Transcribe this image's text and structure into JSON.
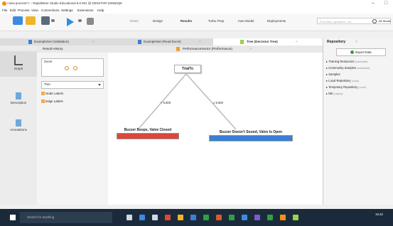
{
  "window": {
    "title": "<new process*> – RapidMiner Studio Educational 9.0.001 @ DESKTOP-2SNB3QK",
    "min": "–",
    "max": "□"
  },
  "menu": [
    "File",
    "Edit",
    "Process",
    "View",
    "Connections",
    "Settings",
    "Extensions",
    "Help"
  ],
  "toolbar": {
    "views_label": "Views:",
    "perspectives": [
      "Design",
      "Results",
      "Turbo Prep",
      "Auto Model",
      "Deployments"
    ],
    "active": "Results",
    "search_placeholder": "Find data, operators...etc",
    "all_studio": "All Studio"
  },
  "tabs": [
    {
      "label": "ExampleSet (Validation)",
      "close": "×"
    },
    {
      "label": "ExampleSet (Read Excel)",
      "close": "×"
    },
    {
      "label": "Tree (Decision Tree)",
      "close": "×"
    }
  ],
  "result_history": "Result History",
  "performance_tab": "PerformanceVector (Performance)",
  "performance_close": "×",
  "leftnav": [
    "Graph",
    "Description",
    "Annotations"
  ],
  "controls": {
    "zoom_label": "Zoom",
    "tree_select": "Tree",
    "node_labels": "Node Labels",
    "edge_labels": "Edge Labels",
    "check": "✓"
  },
  "tree": {
    "root": "TrialTo",
    "left_edge": "< 5.500",
    "right_edge": "≥ 5.500",
    "left_leaf": "Buzzer Beeps, Valve Closed",
    "right_leaf": "Buzzer Doesn't Sound, Valve Is Open"
  },
  "repo": {
    "title": "Repository",
    "close": "×",
    "import_label": "Import Data",
    "items": [
      {
        "label": "Training Resources",
        "conn": "(connected)"
      },
      {
        "label": "Community Samples",
        "conn": "(connected)"
      },
      {
        "label": "Samples",
        "conn": ""
      },
      {
        "label": "Local Repository",
        "conn": "(Local)"
      },
      {
        "label": "Temporary Repository",
        "conn": "(Local)"
      },
      {
        "label": "DB",
        "conn": "(Legacy)"
      }
    ]
  },
  "taskbar": {
    "search": "Search for anything",
    "time": "16:42"
  },
  "colors": {
    "leaf_left": "#e0453a",
    "leaf_right": "#3a7fd5",
    "accent": "#2ea043"
  }
}
